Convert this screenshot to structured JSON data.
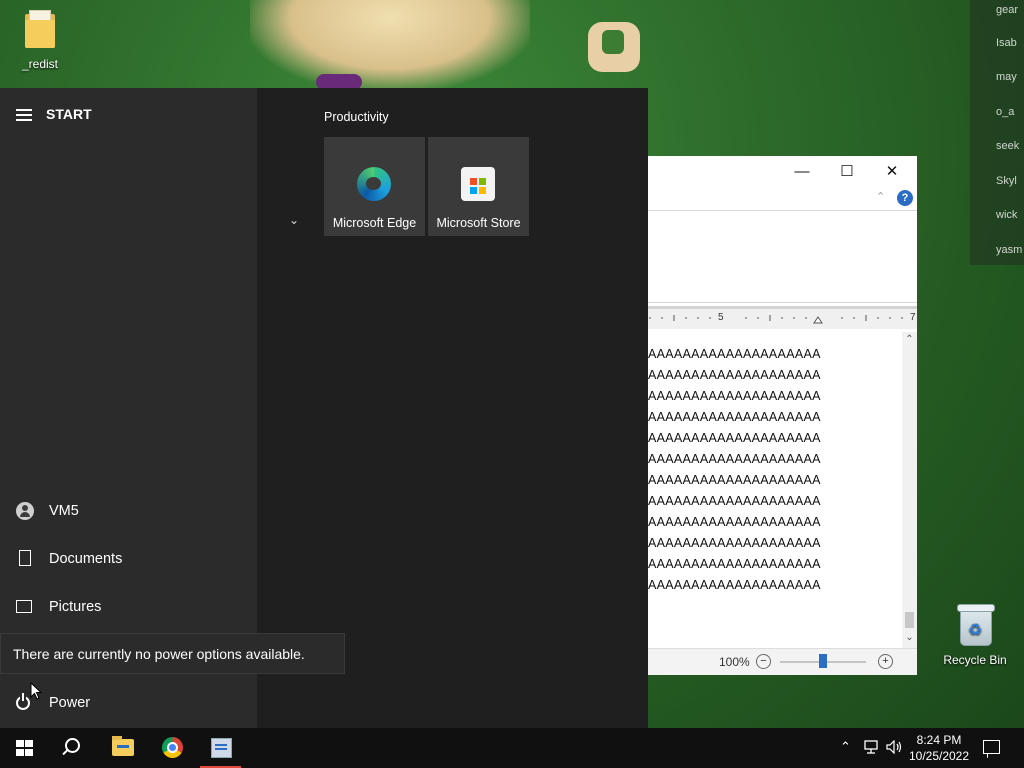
{
  "desktop": {
    "icons": [
      {
        "label": "_redist"
      },
      {
        "label": "Recycle Bin"
      }
    ],
    "chat_fragments": [
      "gear",
      "Isab",
      "may",
      "o_a",
      "seek",
      "Skyl",
      "wick",
      "yasm"
    ]
  },
  "start_menu": {
    "title": "START",
    "user": "VM5",
    "documents": "Documents",
    "pictures": "Pictures",
    "power": "Power",
    "power_tooltip": "There are currently no power options available.",
    "group_title": "Productivity",
    "tiles": [
      {
        "label": "Microsoft Edge",
        "icon": "edge-icon"
      },
      {
        "label": "Microsoft Store",
        "icon": "store-icon"
      }
    ]
  },
  "word_window": {
    "help": "?",
    "ruler_mark": "5",
    "ruler_end": "7",
    "doc_lines": [
      "AAAAAAAAAAAAAAAAAAAA",
      "AAAAAAAAAAAAAAAAAAAA",
      "AAAAAAAAAAAAAAAAAAAA",
      "AAAAAAAAAAAAAAAAAAAA",
      "AAAAAAAAAAAAAAAAAAAA",
      "AAAAAAAAAAAAAAAAAAAA",
      "AAAAAAAAAAAAAAAAAAAA",
      "AAAAAAAAAAAAAAAAAAAA",
      "AAAAAAAAAAAAAAAAAAAA",
      "AAAAAAAAAAAAAAAAAAAA",
      "AAAAAAAAAAAAAAAAAAAA",
      "AAAAAAAAAAAAAAAAAAAA"
    ],
    "zoom": "100%"
  },
  "taskbar": {
    "time": "8:24 PM",
    "date": "10/25/2022"
  },
  "colors": {
    "accent": "#2b6cc4",
    "start_bg": "#1f1f1f",
    "taskbar_bg": "#101010"
  }
}
